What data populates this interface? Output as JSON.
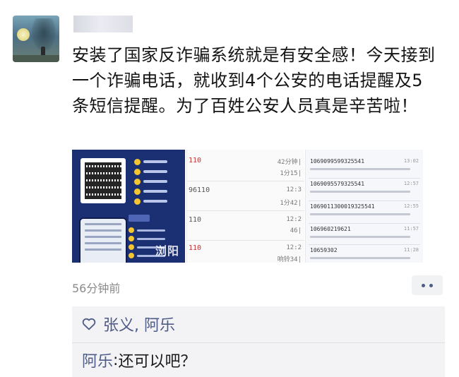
{
  "post": {
    "text": "安装了国家反诈骗系统就是有安全感！今天接到一个诈骗电话，就收到4个公安的电话提醒及5条短信提醒。为了百姓公安人员真是辛苦啦！",
    "time_ago": "56分钟前"
  },
  "images": {
    "image1": {
      "watermark": "浏阳"
    },
    "image2": {
      "rows": [
        {
          "num": "110",
          "right": "42分钟|",
          "red": true
        },
        {
          "num": "",
          "right": "1分15|",
          "red": false
        },
        {
          "num": "96110",
          "right": "12:3",
          "red": false
        },
        {
          "num": "",
          "right": "1分42|",
          "red": false
        },
        {
          "num": "110",
          "right": "12:2",
          "red": false
        },
        {
          "num": "",
          "right": "46|",
          "red": false
        },
        {
          "num": "110",
          "right": "12:2",
          "red": true
        },
        {
          "num": "",
          "right": "响铃34|",
          "red": false
        }
      ]
    },
    "image3": {
      "messages": [
        {
          "num": "1069099599325541",
          "time": "13:02"
        },
        {
          "num": "1069095579325541",
          "time": "12:57"
        },
        {
          "num": "1069011300019325541",
          "time": "12:55"
        },
        {
          "num": "106960219621",
          "time": "11:57"
        },
        {
          "num": "10659302",
          "time": "11:28"
        }
      ]
    }
  },
  "interaction": {
    "likes": "张义, 阿乐",
    "comment": {
      "author": "阿乐",
      "separator": ": ",
      "text": "还可以吧？"
    }
  },
  "colors": {
    "link": "#4d5b86",
    "panel_bg": "#f3f3f5",
    "time_gray": "#8a8a8a"
  }
}
